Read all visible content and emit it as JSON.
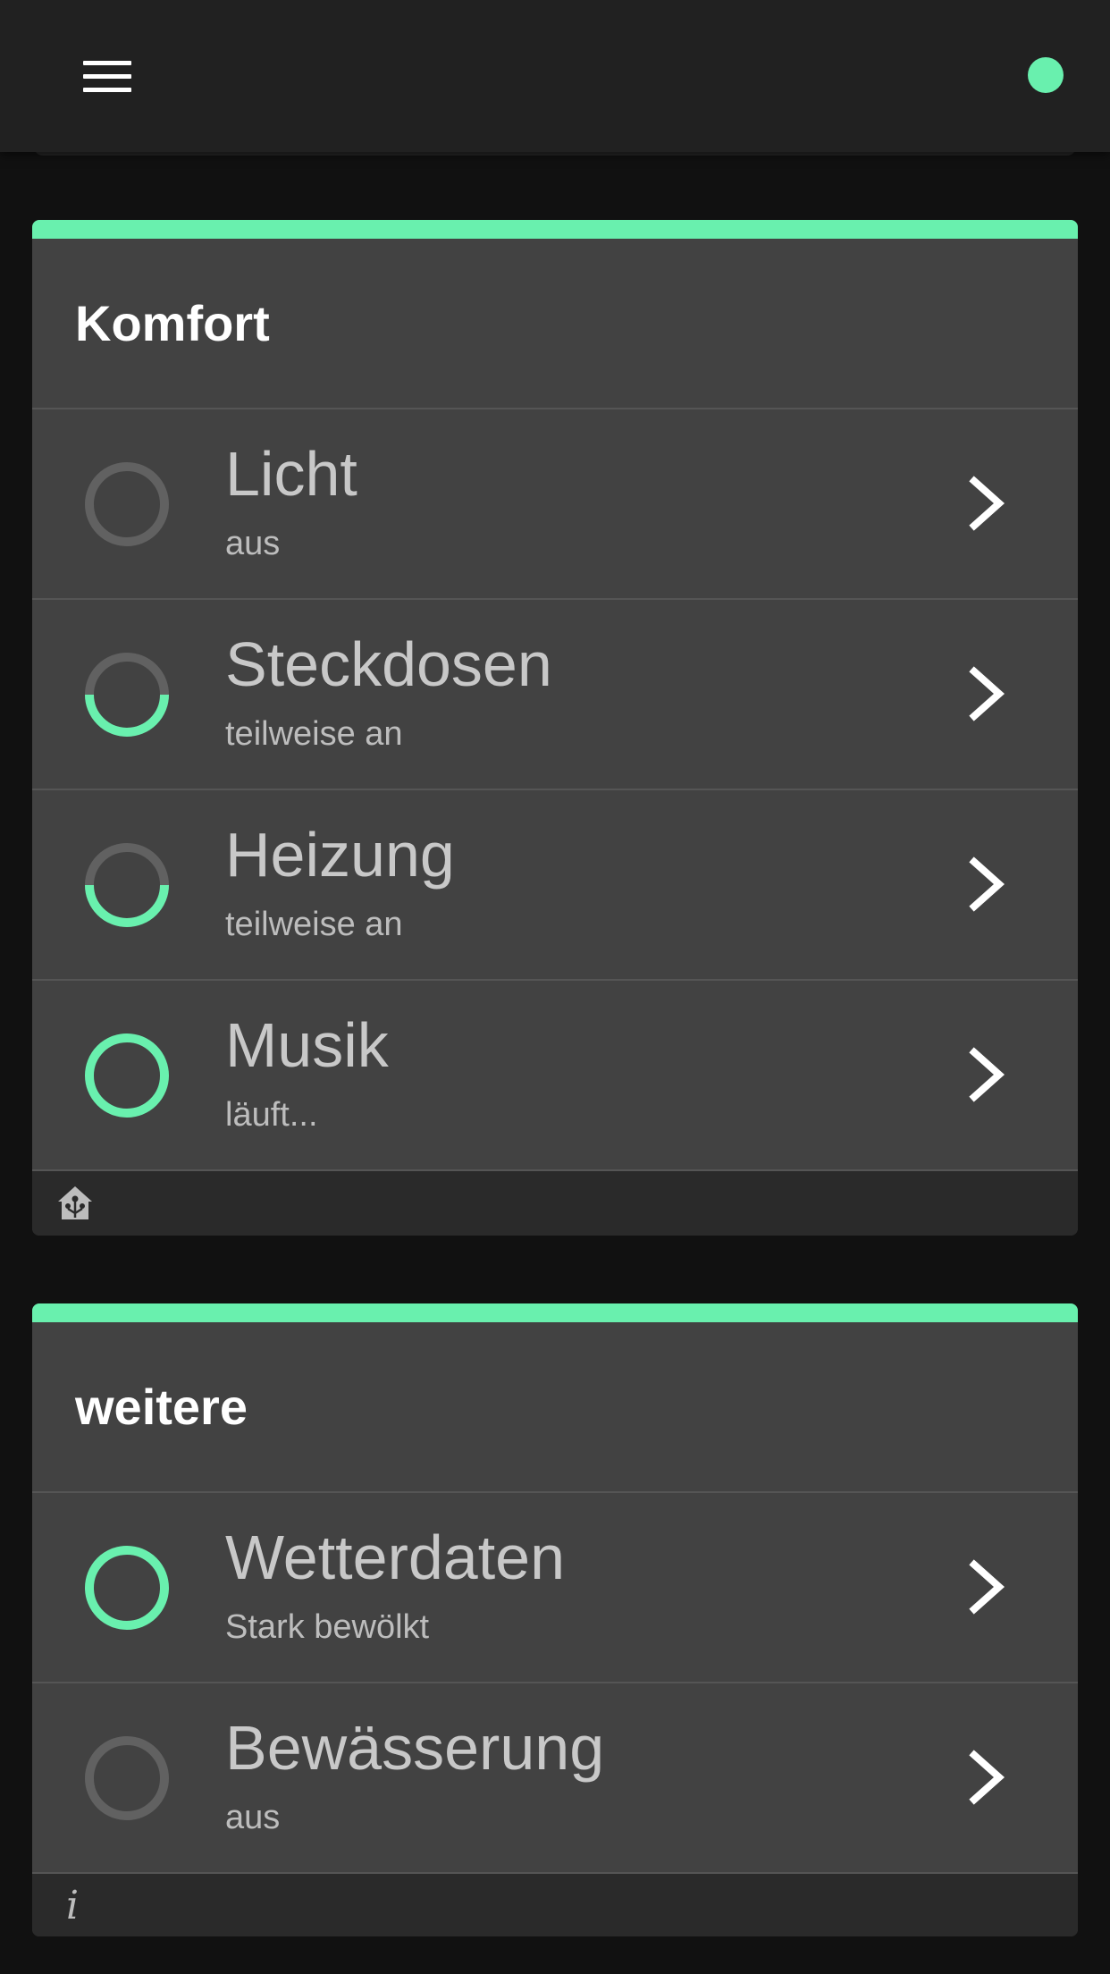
{
  "colors": {
    "accent": "#69f0ae",
    "ring_off": "#616161",
    "card": "#424242",
    "background": "#111111",
    "topbar": "#212121"
  },
  "topbar": {
    "menu_icon": "hamburger-menu-icon",
    "status_icon": "connection-status-dot"
  },
  "cards": [
    {
      "title": "Komfort",
      "footer_icon": "home-assistant-icon",
      "rows": [
        {
          "label": "Licht",
          "status": "aus",
          "state": "off",
          "icon": "status-ring-icon"
        },
        {
          "label": "Steckdosen",
          "status": "teilweise an",
          "state": "partial",
          "icon": "status-ring-icon"
        },
        {
          "label": "Heizung",
          "status": "teilweise an",
          "state": "partial",
          "icon": "status-ring-icon"
        },
        {
          "label": "Musik",
          "status": "läuft...",
          "state": "on",
          "icon": "status-ring-icon"
        }
      ]
    },
    {
      "title": "weitere",
      "footer_icon": "info-icon",
      "footer_text": "i",
      "rows": [
        {
          "label": "Wetterdaten",
          "status": "Stark bewölkt",
          "state": "on",
          "icon": "status-ring-icon"
        },
        {
          "label": "Bewässerung",
          "status": "aus",
          "state": "off",
          "icon": "status-ring-icon"
        }
      ]
    }
  ]
}
